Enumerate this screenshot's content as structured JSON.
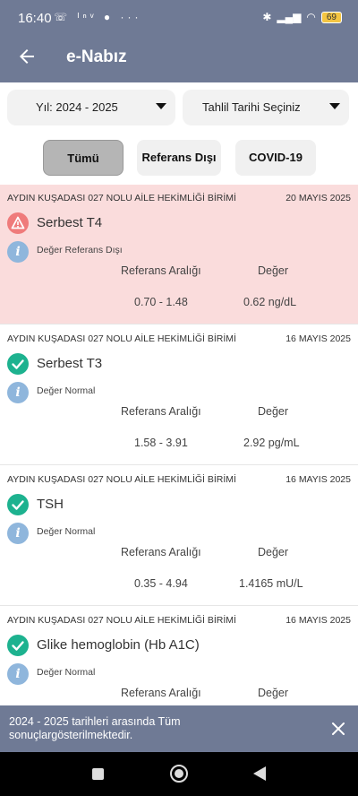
{
  "status_bar": {
    "time": "16:40",
    "indicators": "☏ ᴵⁿᵛ ● ···",
    "battery": "69"
  },
  "header": {
    "title": "e-Nabız"
  },
  "filters": {
    "year_label": "Yıl: 2024 - 2025",
    "date_placeholder": "Tahlil Tarihi Seçiniz"
  },
  "tabs": {
    "all": "Tümü",
    "out_of_range": "Referans Dışı",
    "covid": "COVID-19"
  },
  "results": [
    {
      "clinic": "AYDIN KUŞADASI 027 NOLU AİLE HEKİMLİĞİ BİRİMİ",
      "date": "20 MAYIS 2025",
      "test": "Serbest T4",
      "status": "Değer Referans Dışı",
      "range_header": "Referans Aralığı",
      "value_header": "Değer",
      "range": "0.70 - 1.48",
      "value": "0.62 ng/dL",
      "alert": true
    },
    {
      "clinic": "AYDIN KUŞADASI 027 NOLU AİLE HEKİMLİĞİ BİRİMİ",
      "date": "16 MAYIS 2025",
      "test": "Serbest T3",
      "status": "Değer Normal",
      "range_header": "Referans Aralığı",
      "value_header": "Değer",
      "range": "1.58 - 3.91",
      "value": "2.92 pg/mL",
      "alert": false
    },
    {
      "clinic": "AYDIN KUŞADASI 027 NOLU AİLE HEKİMLİĞİ BİRİMİ",
      "date": "16 MAYIS 2025",
      "test": "TSH",
      "status": "Değer Normal",
      "range_header": "Referans Aralığı",
      "value_header": "Değer",
      "range": "0.35 - 4.94",
      "value": "1.4165 mU/L",
      "alert": false
    },
    {
      "clinic": "AYDIN KUŞADASI 027 NOLU AİLE HEKİMLİĞİ BİRİMİ",
      "date": "16 MAYIS 2025",
      "test": "Glike hemoglobin (Hb A1C)",
      "status": "Değer Normal",
      "range_header": "Referans Aralığı",
      "value_header": "Değer",
      "range": "",
      "value": "",
      "alert": false
    }
  ],
  "snackbar": {
    "message": "2024 - 2025 tarihleri arasında Tüm sonuçlargösterilmektedir."
  },
  "colors": {
    "primary": "#6f7a95",
    "alert_bg": "#fadcdc",
    "alert_icon": "#ef7b7b",
    "ok_icon": "#1db28f",
    "info_icon": "#8fb6dc"
  }
}
